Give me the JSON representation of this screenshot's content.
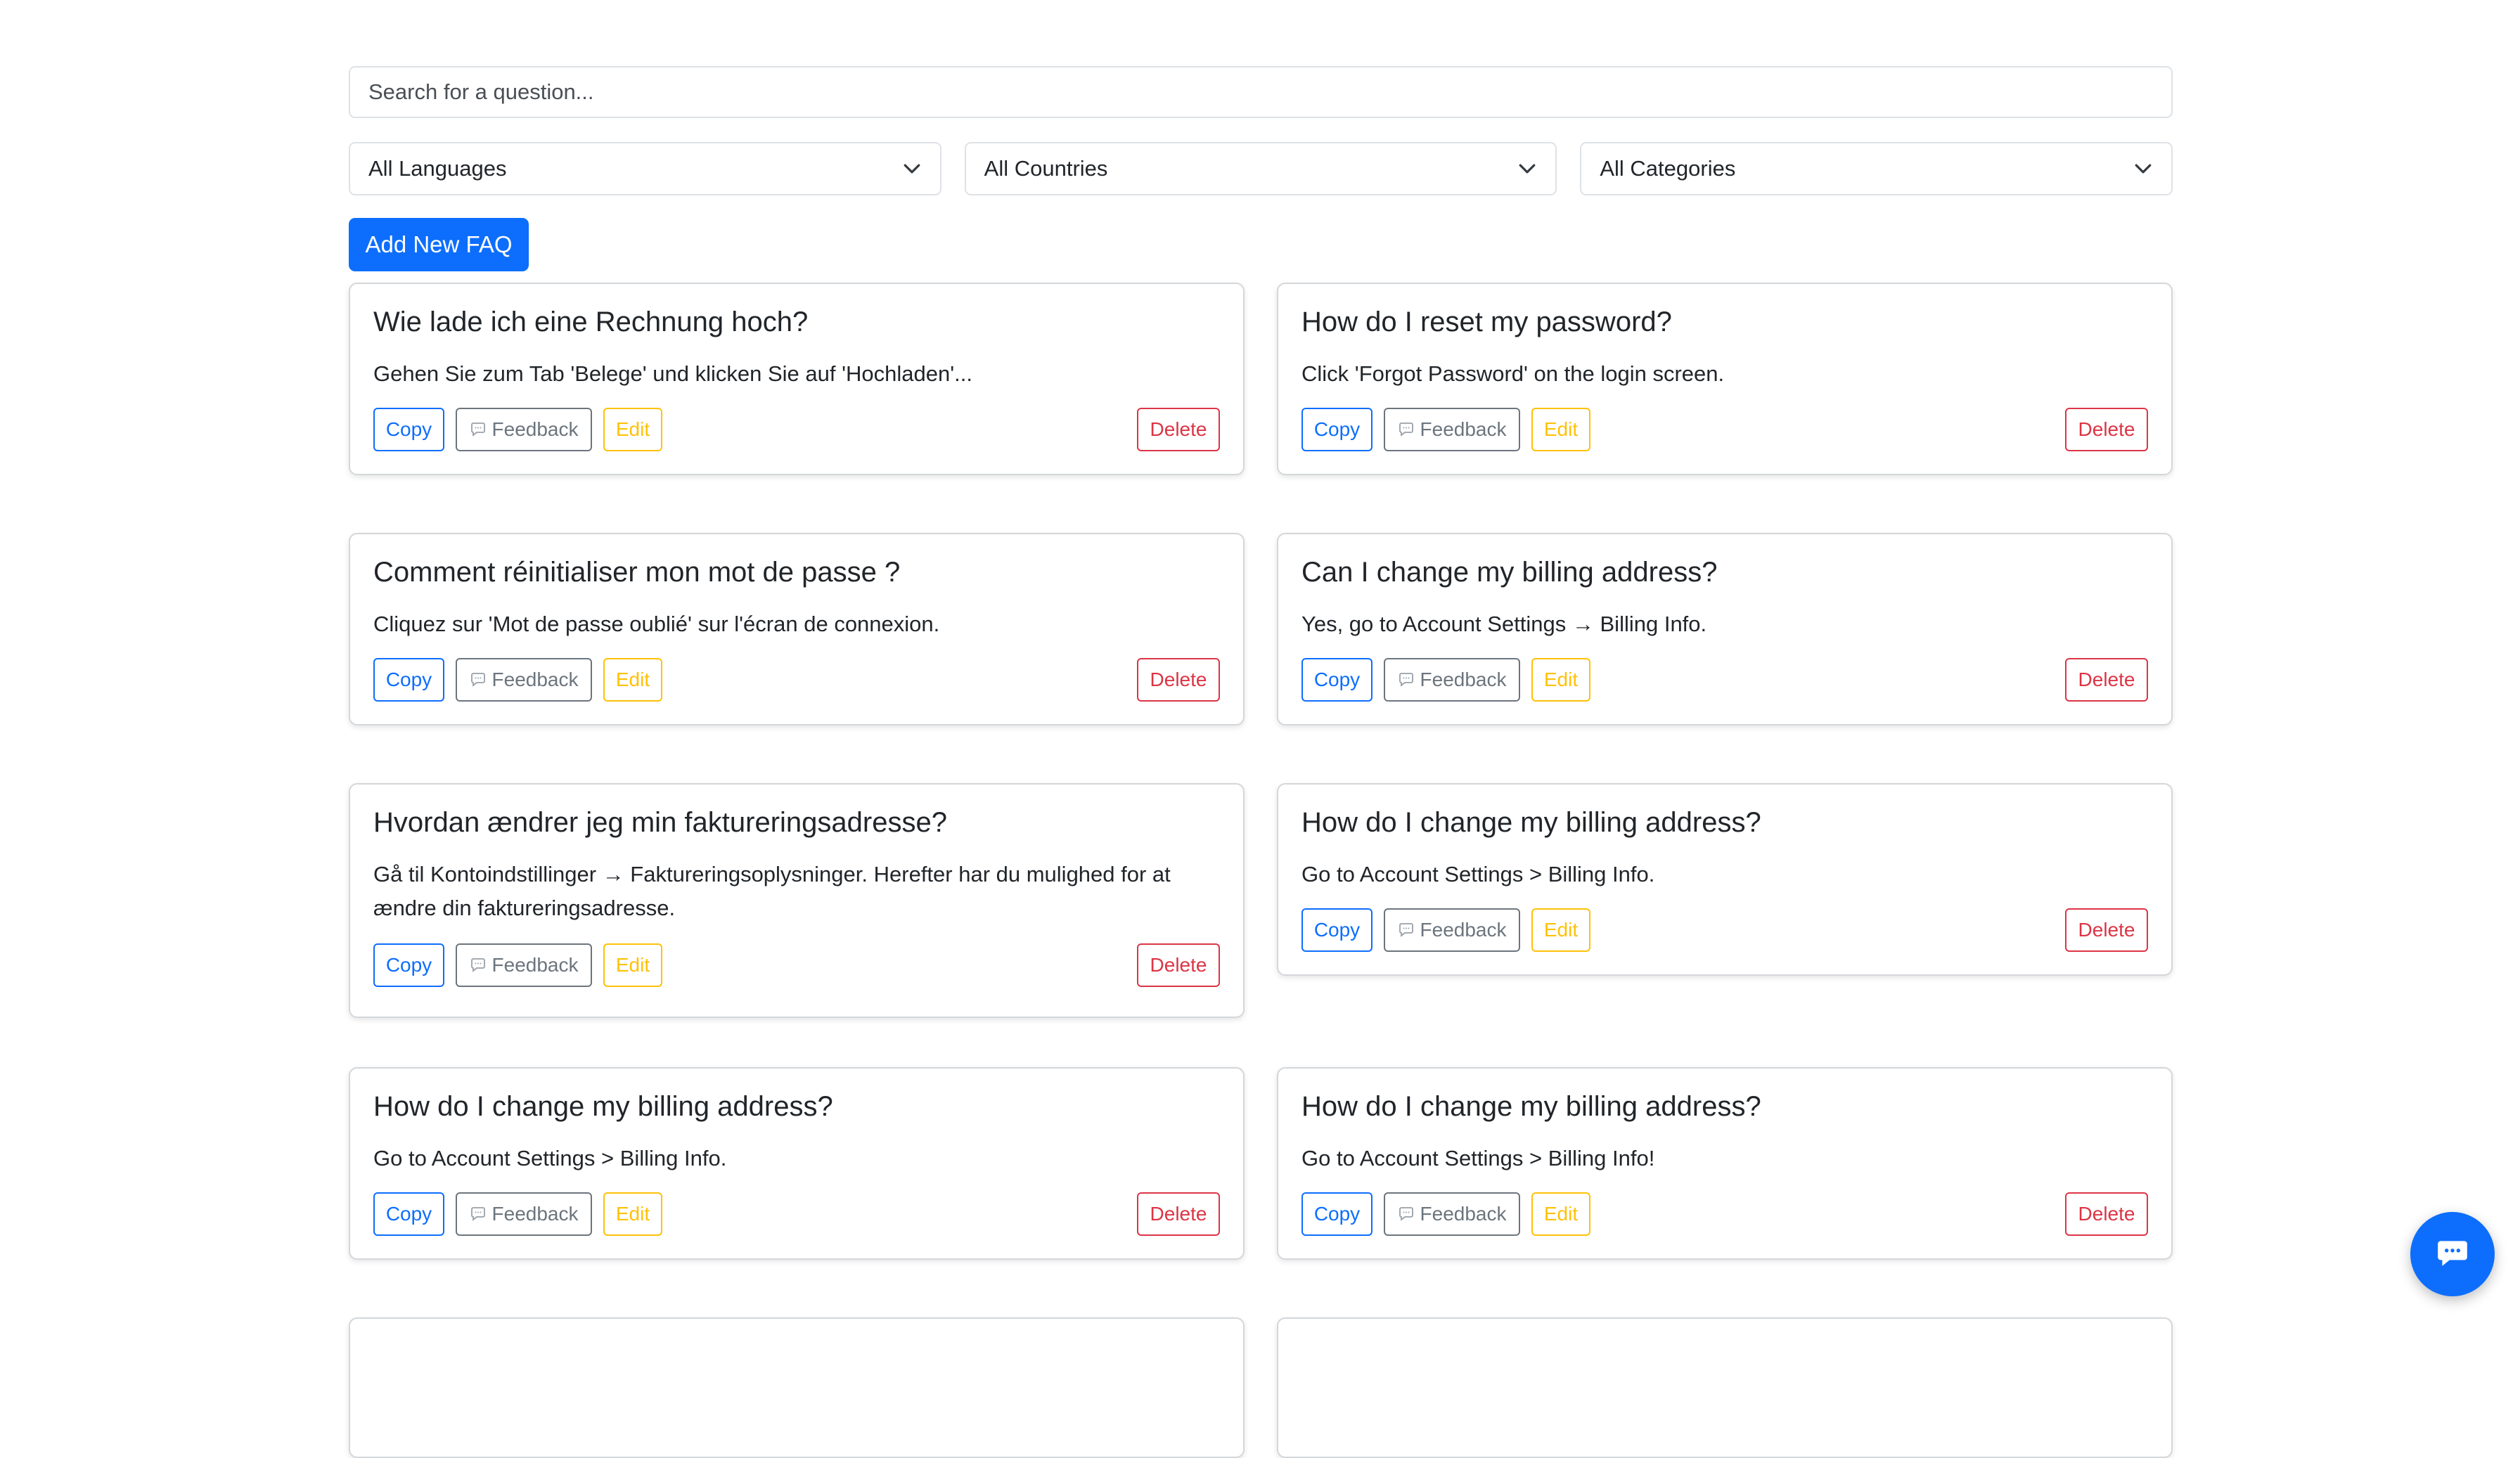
{
  "search": {
    "placeholder": "Search for a question..."
  },
  "filters": {
    "language": "All Languages",
    "country": "All Countries",
    "category": "All Categories"
  },
  "add_button_label": "Add New FAQ",
  "card_actions": {
    "copy": "Copy",
    "feedback": "Feedback",
    "edit": "Edit",
    "delete": "Delete"
  },
  "faqs": [
    {
      "question": "Wie lade ich eine Rechnung hoch?",
      "answer": "Gehen Sie zum Tab 'Belege' und klicken Sie auf 'Hochladen'..."
    },
    {
      "question": "How do I reset my password?",
      "answer": "Click 'Forgot Password' on the login screen."
    },
    {
      "question": "Comment réinitialiser mon mot de passe ?",
      "answer": "Cliquez sur 'Mot de passe oublié' sur l'écran de connexion."
    },
    {
      "question": "Can I change my billing address?",
      "answer": "Yes, go to Account Settings → Billing Info."
    },
    {
      "question": "Hvordan ændrer jeg min faktureringsadresse?",
      "answer": "Gå til Kontoindstillinger → Faktureringsoplysninger. Herefter har du mulighed for at ændre din faktureringsadresse."
    },
    {
      "question": "How do I change my billing address?",
      "answer": "Go to Account Settings > Billing Info."
    },
    {
      "question": "How do I change my billing address?",
      "answer": "Go to Account Settings > Billing Info."
    },
    {
      "question": "How do I change my billing address?",
      "answer": "Go to Account Settings > Billing Info!"
    }
  ],
  "icons": {
    "select_chevron": "chevron-down-icon",
    "feedback": "speech-bubble-icon",
    "chat": "chat-bubble-icon"
  },
  "colors": {
    "primary": "#0d6efd",
    "secondary": "#6c757d",
    "warning": "#ffc107",
    "danger": "#dc3545"
  }
}
